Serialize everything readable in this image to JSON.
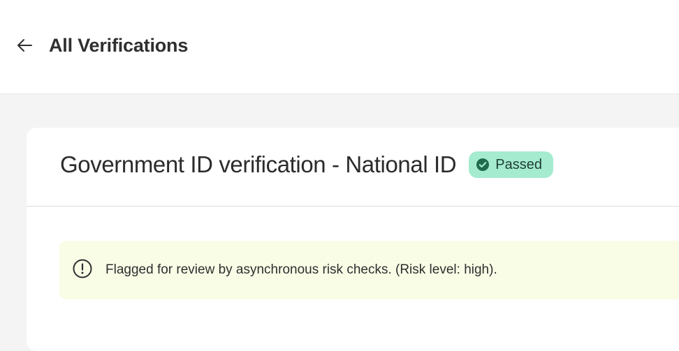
{
  "header": {
    "back_label": "All Verifications"
  },
  "verification": {
    "title": "Government ID verification - National ID",
    "status": "Passed"
  },
  "alert": {
    "message": "Flagged for review by asynchronous risk checks. (Risk level: high)."
  },
  "colors": {
    "badge_bg": "#a4ebd0",
    "badge_icon": "#1f6b4e",
    "alert_bg": "#f9fde6",
    "page_bg": "#f4f4f4"
  },
  "icons": {
    "back": "arrow-left-icon",
    "status": "check-circle-icon",
    "alert": "exclamation-circle-icon"
  }
}
